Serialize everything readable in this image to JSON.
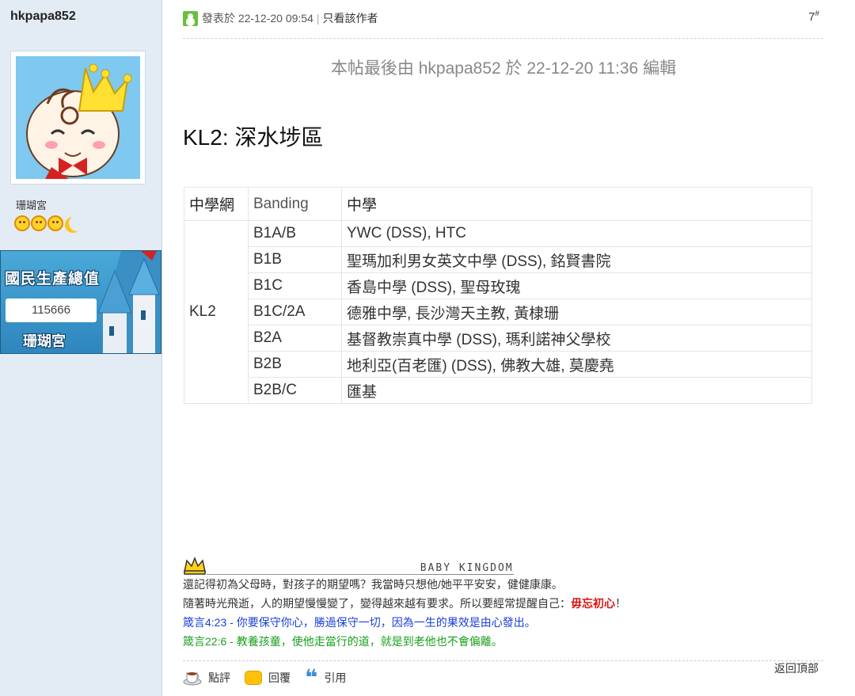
{
  "user": {
    "username": "hkpapa852",
    "group": "珊瑚宮",
    "rank_icons": [
      "face-icon",
      "face-icon",
      "face-icon",
      "moon-icon"
    ],
    "medal": {
      "title": "國民生產總值",
      "value": "115666",
      "subtitle": "珊瑚宮"
    }
  },
  "post": {
    "posted_label": "發表於",
    "posted_time": "22-12-20 09:54",
    "author_only": "只看該作者",
    "floor_number": "7",
    "floor_mark": "#",
    "edit_note": "本帖最後由 hkpapa852 於 22-12-20 11:36 編輯",
    "heading": "KL2: 深水埗區",
    "table": {
      "headers": [
        "中學網",
        "Banding",
        "中學"
      ],
      "region": "KL2",
      "rows": [
        {
          "band": "B1A/B",
          "schools": "YWC  (DSS), HTC"
        },
        {
          "band": "B1B",
          "schools": "聖瑪加利男女英文中學 (DSS), 銘賢書院"
        },
        {
          "band": "B1C",
          "schools": "香島中學  (DSS), 聖母玫瑰"
        },
        {
          "band": "B1C/2A",
          "schools": "德雅中學,  長沙灣天主教, 黃棣珊"
        },
        {
          "band": "B2A",
          "schools": "基督教崇真中學  (DSS), 瑪利諾神父學校"
        },
        {
          "band": "B2B",
          "schools": "地利亞(百老匯)  (DSS), 佛教大雄, 莫慶堯"
        },
        {
          "band": "B2B/C",
          "schools": "匯基"
        }
      ]
    }
  },
  "signature": {
    "dashes": "________________________________",
    "brand": "BABY KINGDOM",
    "line1": "還記得初為父母時，對孩子的期望嗎？我當時只想他/她平平安安，健健康康。",
    "line2_prefix": "隨著時光飛逝，人的期望慢慢變了，變得越來越有要求。所以要經常提醒自己：",
    "line2_highlight": "毋忘初心",
    "line2_suffix": "！",
    "line3": "箴言4:23 - 你要保守你心，勝過保守一切，因為一生的果效是由心發出。",
    "line4": "箴言22:6 - 教養孩童，使他走當行的道，就是到老他也不會偏離。",
    "colors": {
      "red": "#d11111",
      "blue": "#1a3fd6",
      "green": "#19a01e"
    }
  },
  "footer": {
    "back_to_top": "返回頂部",
    "actions": [
      {
        "label": "點評",
        "icon": "coffee-cup-icon"
      },
      {
        "label": "回覆",
        "icon": "speech-bubble-icon"
      },
      {
        "label": "引用",
        "icon": "quote-icon"
      }
    ]
  }
}
